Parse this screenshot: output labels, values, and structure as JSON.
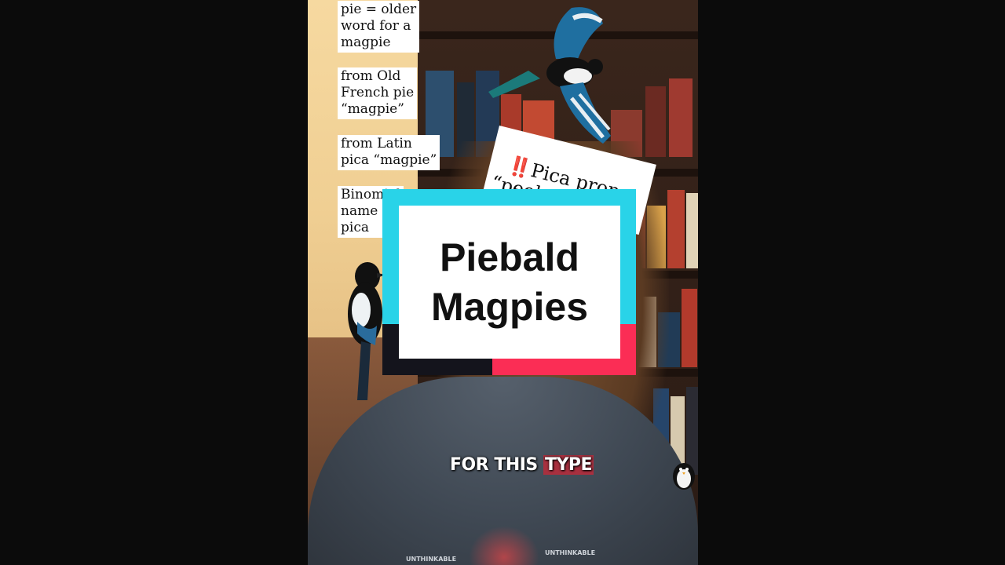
{
  "notes": [
    {
      "text": "pie = older\nword for a\nmagpie"
    },
    {
      "text": "from Old\nFrench pie\n“magpie”"
    },
    {
      "text": "from Latin\npica “magpie”"
    },
    {
      "text": "Binomial\nname\npica"
    }
  ],
  "tilted_note": {
    "alert": "‼️",
    "text": "Pica pron.\n“peeka” in\nLatin"
  },
  "card": {
    "title": "Piebald\nMagpies"
  },
  "caption": {
    "lead": "FOR THIS ",
    "highlight": "TYPE"
  },
  "shirt_text": [
    "UNTHINKABLE",
    "UNTHINKABLE"
  ],
  "colors": {
    "cyan": "#29d3e8",
    "red": "#fb2d55",
    "dark": "#14141c"
  }
}
